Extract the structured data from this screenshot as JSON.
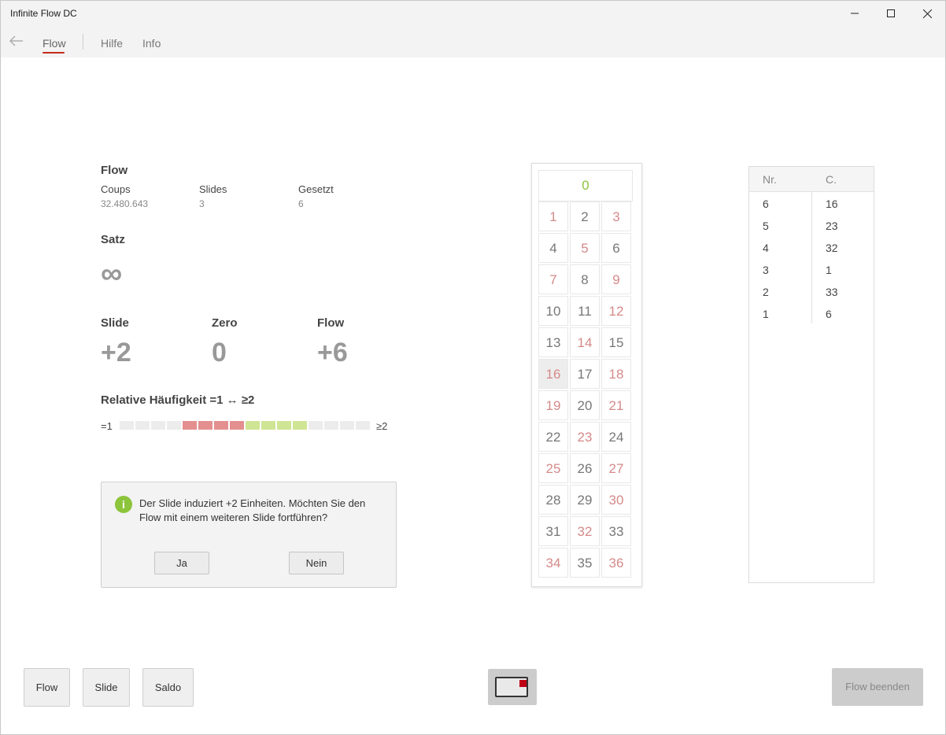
{
  "window": {
    "title": "Infinite Flow DC"
  },
  "nav": {
    "items": [
      "Flow",
      "Hilfe",
      "Info"
    ],
    "active": "Flow"
  },
  "stats": {
    "heading": "Flow",
    "coups_label": "Coups",
    "coups_value": "32.480.643",
    "slides_label": "Slides",
    "slides_value": "3",
    "gesetzt_label": "Gesetzt",
    "gesetzt_value": "6"
  },
  "satz": {
    "heading": "Satz",
    "value": "∞"
  },
  "indicators": {
    "slide_label": "Slide",
    "slide_value": "+2",
    "zero_label": "Zero",
    "zero_value": "0",
    "flow_label": "Flow",
    "flow_value": "+6"
  },
  "frequency": {
    "heading": "Relative Häufigkeit =1 ↔ ≥2",
    "left_label": "=1",
    "right_label": "≥2",
    "cells": [
      "empty",
      "empty",
      "empty",
      "empty",
      "red",
      "red",
      "red",
      "red",
      "green",
      "green",
      "green",
      "green",
      "empty",
      "empty",
      "empty",
      "empty"
    ],
    "colors": {
      "empty": "#ececec",
      "red": "#e48f8f",
      "green": "#cfe594"
    }
  },
  "dialog": {
    "icon": "info-icon",
    "icon_glyph": "i",
    "message": "Der Slide induziert +2 Einheiten. Möchten Sie den Flow mit einem weiteren Slide fortführen?",
    "yes_label": "Ja",
    "no_label": "Nein"
  },
  "wheel": {
    "zero": "0",
    "numbers": [
      {
        "n": "1",
        "c": "red"
      },
      {
        "n": "2",
        "c": "black"
      },
      {
        "n": "3",
        "c": "red"
      },
      {
        "n": "4",
        "c": "black"
      },
      {
        "n": "5",
        "c": "red"
      },
      {
        "n": "6",
        "c": "black"
      },
      {
        "n": "7",
        "c": "red"
      },
      {
        "n": "8",
        "c": "black"
      },
      {
        "n": "9",
        "c": "red"
      },
      {
        "n": "10",
        "c": "black"
      },
      {
        "n": "11",
        "c": "black"
      },
      {
        "n": "12",
        "c": "red"
      },
      {
        "n": "13",
        "c": "black"
      },
      {
        "n": "14",
        "c": "red"
      },
      {
        "n": "15",
        "c": "black"
      },
      {
        "n": "16",
        "c": "red",
        "selected": true
      },
      {
        "n": "17",
        "c": "black"
      },
      {
        "n": "18",
        "c": "red"
      },
      {
        "n": "19",
        "c": "red"
      },
      {
        "n": "20",
        "c": "black"
      },
      {
        "n": "21",
        "c": "red"
      },
      {
        "n": "22",
        "c": "black"
      },
      {
        "n": "23",
        "c": "red"
      },
      {
        "n": "24",
        "c": "black"
      },
      {
        "n": "25",
        "c": "red"
      },
      {
        "n": "26",
        "c": "black"
      },
      {
        "n": "27",
        "c": "red"
      },
      {
        "n": "28",
        "c": "black"
      },
      {
        "n": "29",
        "c": "black"
      },
      {
        "n": "30",
        "c": "red"
      },
      {
        "n": "31",
        "c": "black"
      },
      {
        "n": "32",
        "c": "red"
      },
      {
        "n": "33",
        "c": "black"
      },
      {
        "n": "34",
        "c": "red"
      },
      {
        "n": "35",
        "c": "black"
      },
      {
        "n": "36",
        "c": "red"
      }
    ]
  },
  "history": {
    "col_nr": "Nr.",
    "col_c": "C.",
    "rows": [
      {
        "nr": "6",
        "c": "16"
      },
      {
        "nr": "5",
        "c": "23"
      },
      {
        "nr": "4",
        "c": "32"
      },
      {
        "nr": "3",
        "c": "1"
      },
      {
        "nr": "2",
        "c": "33"
      },
      {
        "nr": "1",
        "c": "6"
      }
    ]
  },
  "footer": {
    "flow_label": "Flow",
    "slide_label": "Slide",
    "saldo_label": "Saldo",
    "end_label": "Flow beenden",
    "toggle_icon": "toggle-icon"
  }
}
